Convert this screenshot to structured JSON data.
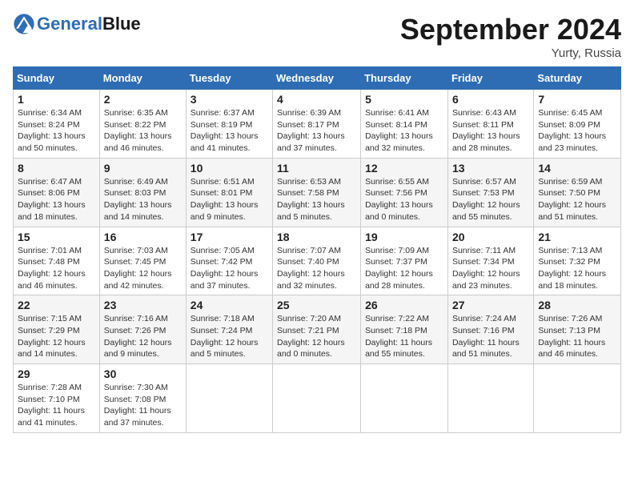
{
  "header": {
    "logo_general": "General",
    "logo_blue": "Blue",
    "month_year": "September 2024",
    "location": "Yurty, Russia"
  },
  "calendar": {
    "days_of_week": [
      "Sunday",
      "Monday",
      "Tuesday",
      "Wednesday",
      "Thursday",
      "Friday",
      "Saturday"
    ],
    "weeks": [
      [
        {
          "day": "1",
          "sunrise": "6:34 AM",
          "sunset": "8:24 PM",
          "daylight": "13 hours and 50 minutes."
        },
        {
          "day": "2",
          "sunrise": "6:35 AM",
          "sunset": "8:22 PM",
          "daylight": "13 hours and 46 minutes."
        },
        {
          "day": "3",
          "sunrise": "6:37 AM",
          "sunset": "8:19 PM",
          "daylight": "13 hours and 41 minutes."
        },
        {
          "day": "4",
          "sunrise": "6:39 AM",
          "sunset": "8:17 PM",
          "daylight": "13 hours and 37 minutes."
        },
        {
          "day": "5",
          "sunrise": "6:41 AM",
          "sunset": "8:14 PM",
          "daylight": "13 hours and 32 minutes."
        },
        {
          "day": "6",
          "sunrise": "6:43 AM",
          "sunset": "8:11 PM",
          "daylight": "13 hours and 28 minutes."
        },
        {
          "day": "7",
          "sunrise": "6:45 AM",
          "sunset": "8:09 PM",
          "daylight": "13 hours and 23 minutes."
        }
      ],
      [
        {
          "day": "8",
          "sunrise": "6:47 AM",
          "sunset": "8:06 PM",
          "daylight": "13 hours and 18 minutes."
        },
        {
          "day": "9",
          "sunrise": "6:49 AM",
          "sunset": "8:03 PM",
          "daylight": "13 hours and 14 minutes."
        },
        {
          "day": "10",
          "sunrise": "6:51 AM",
          "sunset": "8:01 PM",
          "daylight": "13 hours and 9 minutes."
        },
        {
          "day": "11",
          "sunrise": "6:53 AM",
          "sunset": "7:58 PM",
          "daylight": "13 hours and 5 minutes."
        },
        {
          "day": "12",
          "sunrise": "6:55 AM",
          "sunset": "7:56 PM",
          "daylight": "13 hours and 0 minutes."
        },
        {
          "day": "13",
          "sunrise": "6:57 AM",
          "sunset": "7:53 PM",
          "daylight": "12 hours and 55 minutes."
        },
        {
          "day": "14",
          "sunrise": "6:59 AM",
          "sunset": "7:50 PM",
          "daylight": "12 hours and 51 minutes."
        }
      ],
      [
        {
          "day": "15",
          "sunrise": "7:01 AM",
          "sunset": "7:48 PM",
          "daylight": "12 hours and 46 minutes."
        },
        {
          "day": "16",
          "sunrise": "7:03 AM",
          "sunset": "7:45 PM",
          "daylight": "12 hours and 42 minutes."
        },
        {
          "day": "17",
          "sunrise": "7:05 AM",
          "sunset": "7:42 PM",
          "daylight": "12 hours and 37 minutes."
        },
        {
          "day": "18",
          "sunrise": "7:07 AM",
          "sunset": "7:40 PM",
          "daylight": "12 hours and 32 minutes."
        },
        {
          "day": "19",
          "sunrise": "7:09 AM",
          "sunset": "7:37 PM",
          "daylight": "12 hours and 28 minutes."
        },
        {
          "day": "20",
          "sunrise": "7:11 AM",
          "sunset": "7:34 PM",
          "daylight": "12 hours and 23 minutes."
        },
        {
          "day": "21",
          "sunrise": "7:13 AM",
          "sunset": "7:32 PM",
          "daylight": "12 hours and 18 minutes."
        }
      ],
      [
        {
          "day": "22",
          "sunrise": "7:15 AM",
          "sunset": "7:29 PM",
          "daylight": "12 hours and 14 minutes."
        },
        {
          "day": "23",
          "sunrise": "7:16 AM",
          "sunset": "7:26 PM",
          "daylight": "12 hours and 9 minutes."
        },
        {
          "day": "24",
          "sunrise": "7:18 AM",
          "sunset": "7:24 PM",
          "daylight": "12 hours and 5 minutes."
        },
        {
          "day": "25",
          "sunrise": "7:20 AM",
          "sunset": "7:21 PM",
          "daylight": "12 hours and 0 minutes."
        },
        {
          "day": "26",
          "sunrise": "7:22 AM",
          "sunset": "7:18 PM",
          "daylight": "11 hours and 55 minutes."
        },
        {
          "day": "27",
          "sunrise": "7:24 AM",
          "sunset": "7:16 PM",
          "daylight": "11 hours and 51 minutes."
        },
        {
          "day": "28",
          "sunrise": "7:26 AM",
          "sunset": "7:13 PM",
          "daylight": "11 hours and 46 minutes."
        }
      ],
      [
        {
          "day": "29",
          "sunrise": "7:28 AM",
          "sunset": "7:10 PM",
          "daylight": "11 hours and 41 minutes."
        },
        {
          "day": "30",
          "sunrise": "7:30 AM",
          "sunset": "7:08 PM",
          "daylight": "11 hours and 37 minutes."
        },
        null,
        null,
        null,
        null,
        null
      ]
    ]
  }
}
